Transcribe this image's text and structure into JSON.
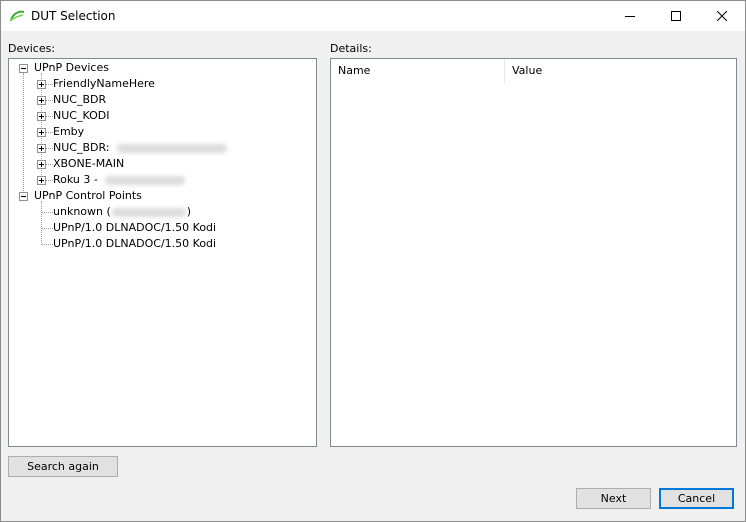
{
  "window": {
    "title": "DUT Selection",
    "icon": "green-swoosh-icon",
    "controls": [
      "minimize-icon",
      "maximize-icon",
      "close-icon"
    ]
  },
  "devices": {
    "label": "Devices:",
    "tree": [
      {
        "label": "UPnP Devices",
        "expanded": true,
        "children": [
          {
            "label": "FriendlyNameHere",
            "expandable": true
          },
          {
            "label": "NUC_BDR",
            "expandable": true
          },
          {
            "label": "NUC_KODI",
            "expandable": true
          },
          {
            "label": "Emby",
            "expandable": true
          },
          {
            "label": "NUC_BDR:",
            "expandable": true,
            "redacted": true
          },
          {
            "label": "XBONE-MAIN",
            "expandable": true
          },
          {
            "label": "Roku 3 -",
            "expandable": true,
            "redacted": true
          }
        ]
      },
      {
        "label": "UPnP Control Points",
        "expanded": true,
        "children": [
          {
            "label_prefix": "unknown (",
            "label_suffix": ")",
            "redacted": true
          },
          {
            "label": "UPnP/1.0 DLNADOC/1.50 Kodi"
          },
          {
            "label": "UPnP/1.0 DLNADOC/1.50 Kodi"
          }
        ]
      }
    ]
  },
  "details": {
    "label": "Details:",
    "columns": [
      "Name",
      "Value"
    ]
  },
  "buttons": {
    "search_again": "Search again",
    "next": "Next",
    "cancel": "Cancel"
  },
  "colors": {
    "accent": "#0078d7",
    "icon_green": "#3aa935"
  }
}
